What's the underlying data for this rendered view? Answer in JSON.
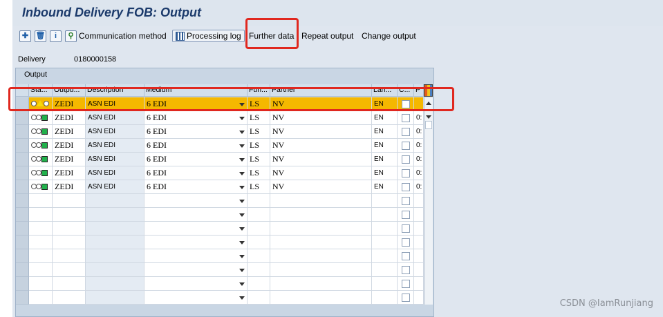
{
  "window": {
    "title": "Inbound Delivery FOB: Output"
  },
  "toolbar": {
    "icons": [
      "new-entry-icon",
      "delete-icon",
      "info-icon"
    ],
    "communication_method": "Communication method",
    "processing_log": "Processing log",
    "further_data": "Further data",
    "repeat_output": "Repeat output",
    "change_output": "Change output"
  },
  "delivery": {
    "label": "Delivery",
    "value": "0180000158"
  },
  "output_panel": {
    "title": "Output",
    "columns": [
      "Sta...",
      "Outpu...",
      "Description",
      "Medium",
      "Fun...",
      "Partner",
      "Lan...",
      "C...",
      "P"
    ],
    "rows": [
      {
        "status": "yellow",
        "output": "ZEDI",
        "description": "ASN EDI",
        "medium": "6 EDI",
        "function": "LS",
        "partner": "NV",
        "language": "EN",
        "p": ""
      },
      {
        "status": "green",
        "output": "ZEDI",
        "description": "ASN EDI",
        "medium": "6 EDI",
        "function": "LS",
        "partner": "NV",
        "language": "EN",
        "p": "0:"
      },
      {
        "status": "green",
        "output": "ZEDI",
        "description": "ASN EDI",
        "medium": "6 EDI",
        "function": "LS",
        "partner": "NV",
        "language": "EN",
        "p": "0:"
      },
      {
        "status": "green",
        "output": "ZEDI",
        "description": "ASN EDI",
        "medium": "6 EDI",
        "function": "LS",
        "partner": "NV",
        "language": "EN",
        "p": "0:"
      },
      {
        "status": "green",
        "output": "ZEDI",
        "description": "ASN EDI",
        "medium": "6 EDI",
        "function": "LS",
        "partner": "NV",
        "language": "EN",
        "p": "0:"
      },
      {
        "status": "green",
        "output": "ZEDI",
        "description": "ASN EDI",
        "medium": "6 EDI",
        "function": "LS",
        "partner": "NV",
        "language": "EN",
        "p": "0:"
      },
      {
        "status": "green",
        "output": "ZEDI",
        "description": "ASN EDI",
        "medium": "6 EDI",
        "function": "LS",
        "partner": "NV",
        "language": "EN",
        "p": "0:"
      }
    ],
    "empty_rows": 8
  },
  "colors": {
    "selected_row": "#f5b800",
    "highlight": "#e0281f",
    "title": "#1b3a6b"
  },
  "watermark": "CSDN @IamRunjiang"
}
